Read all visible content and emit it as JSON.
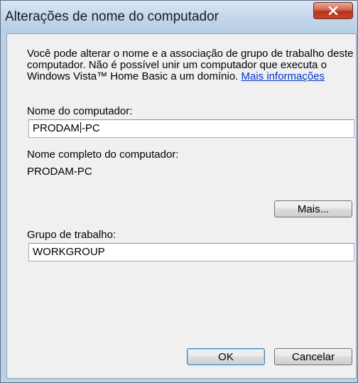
{
  "window": {
    "title": "Alterações de nome do computador",
    "close_icon": "close-x-icon",
    "close_color": "#c9462c"
  },
  "description": {
    "text": "Você pode alterar o nome e a associação de grupo de trabalho deste computador. Não é possível unir um computador que executa o Windows Vista™ Home Basic a um domínio. ",
    "link": "Mais informações"
  },
  "computer_name": {
    "label": "Nome do computador:",
    "value_before_cursor": "PRODAM",
    "value_after_cursor": "-PC"
  },
  "full_computer_name": {
    "label": "Nome completo do computador:",
    "value": "PRODAM-PC"
  },
  "more_button": {
    "label": "Mais..."
  },
  "workgroup": {
    "label": "Grupo de trabalho:",
    "value": "WORKGROUP"
  },
  "footer": {
    "ok_label": "OK",
    "cancel_label": "Cancelar"
  }
}
